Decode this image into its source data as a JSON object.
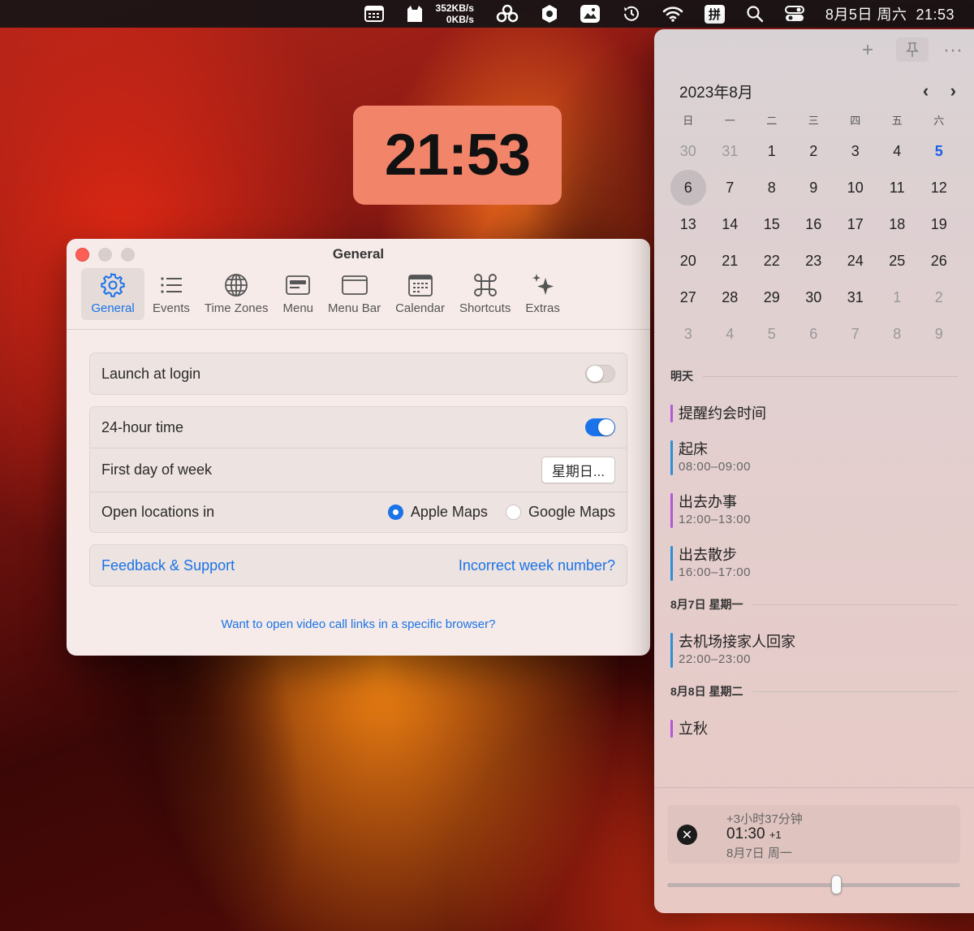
{
  "menubar": {
    "net_up": "352KB/s",
    "net_down": "0KB/s",
    "ime": "拼",
    "clock": "8月5日 周六  21:53"
  },
  "clock_widget": {
    "time": "21:53"
  },
  "settings": {
    "title": "General",
    "tabs": [
      {
        "label": "General",
        "icon": "gear-icon"
      },
      {
        "label": "Events",
        "icon": "list-icon"
      },
      {
        "label": "Time Zones",
        "icon": "globe-icon"
      },
      {
        "label": "Menu",
        "icon": "menu-icon"
      },
      {
        "label": "Menu Bar",
        "icon": "window-icon"
      },
      {
        "label": "Calendar",
        "icon": "calendar-icon"
      },
      {
        "label": "Shortcuts",
        "icon": "command-icon"
      },
      {
        "label": "Extras",
        "icon": "sparkles-icon"
      }
    ],
    "launch_at_login": {
      "label": "Launch at login",
      "on": false
    },
    "hour24": {
      "label": "24-hour time",
      "on": true
    },
    "first_day": {
      "label": "First day of week",
      "value": "星期日..."
    },
    "open_locations": {
      "label": "Open locations in",
      "option1": "Apple Maps",
      "option2": "Google Maps",
      "selected": "Apple Maps"
    },
    "feedback": "Feedback & Support",
    "week_number": "Incorrect week number?",
    "browser_link": "Want to open video call links in a specific browser?"
  },
  "calendar": {
    "month": "2023年8月",
    "weekdays": [
      "日",
      "一",
      "二",
      "三",
      "四",
      "五",
      "六"
    ],
    "weeks": [
      [
        "30",
        "31",
        "1",
        "2",
        "3",
        "4",
        "5"
      ],
      [
        "6",
        "7",
        "8",
        "9",
        "10",
        "11",
        "12"
      ],
      [
        "13",
        "14",
        "15",
        "16",
        "17",
        "18",
        "19"
      ],
      [
        "20",
        "21",
        "22",
        "23",
        "24",
        "25",
        "26"
      ],
      [
        "27",
        "28",
        "29",
        "30",
        "31",
        "1",
        "2"
      ],
      [
        "3",
        "4",
        "5",
        "6",
        "7",
        "8",
        "9"
      ]
    ],
    "sections": [
      {
        "header": "明天",
        "events": [
          {
            "title": "提醒约会时间",
            "time": "",
            "color": "#b457d8"
          },
          {
            "title": "起床",
            "time": "08:00–09:00",
            "color": "#2e8fd6"
          },
          {
            "title": "出去办事",
            "time": "12:00–13:00",
            "color": "#b457d8"
          },
          {
            "title": "出去散步",
            "time": "16:00–17:00",
            "color": "#2e8fd6"
          }
        ]
      },
      {
        "header": "8月7日 星期一",
        "events": [
          {
            "title": "去机场接家人回家",
            "time": "22:00–23:00",
            "color": "#2e8fd6"
          }
        ]
      },
      {
        "header": "8月8日 星期二",
        "events": [
          {
            "title": "立秋",
            "time": "",
            "color": "#b457d8"
          }
        ]
      }
    ],
    "timezone": {
      "diff": "+3小时37分钟",
      "time": "01:30",
      "day_offset": "+1",
      "date": "8月7日 周一",
      "slider_fraction": 0.58
    }
  }
}
